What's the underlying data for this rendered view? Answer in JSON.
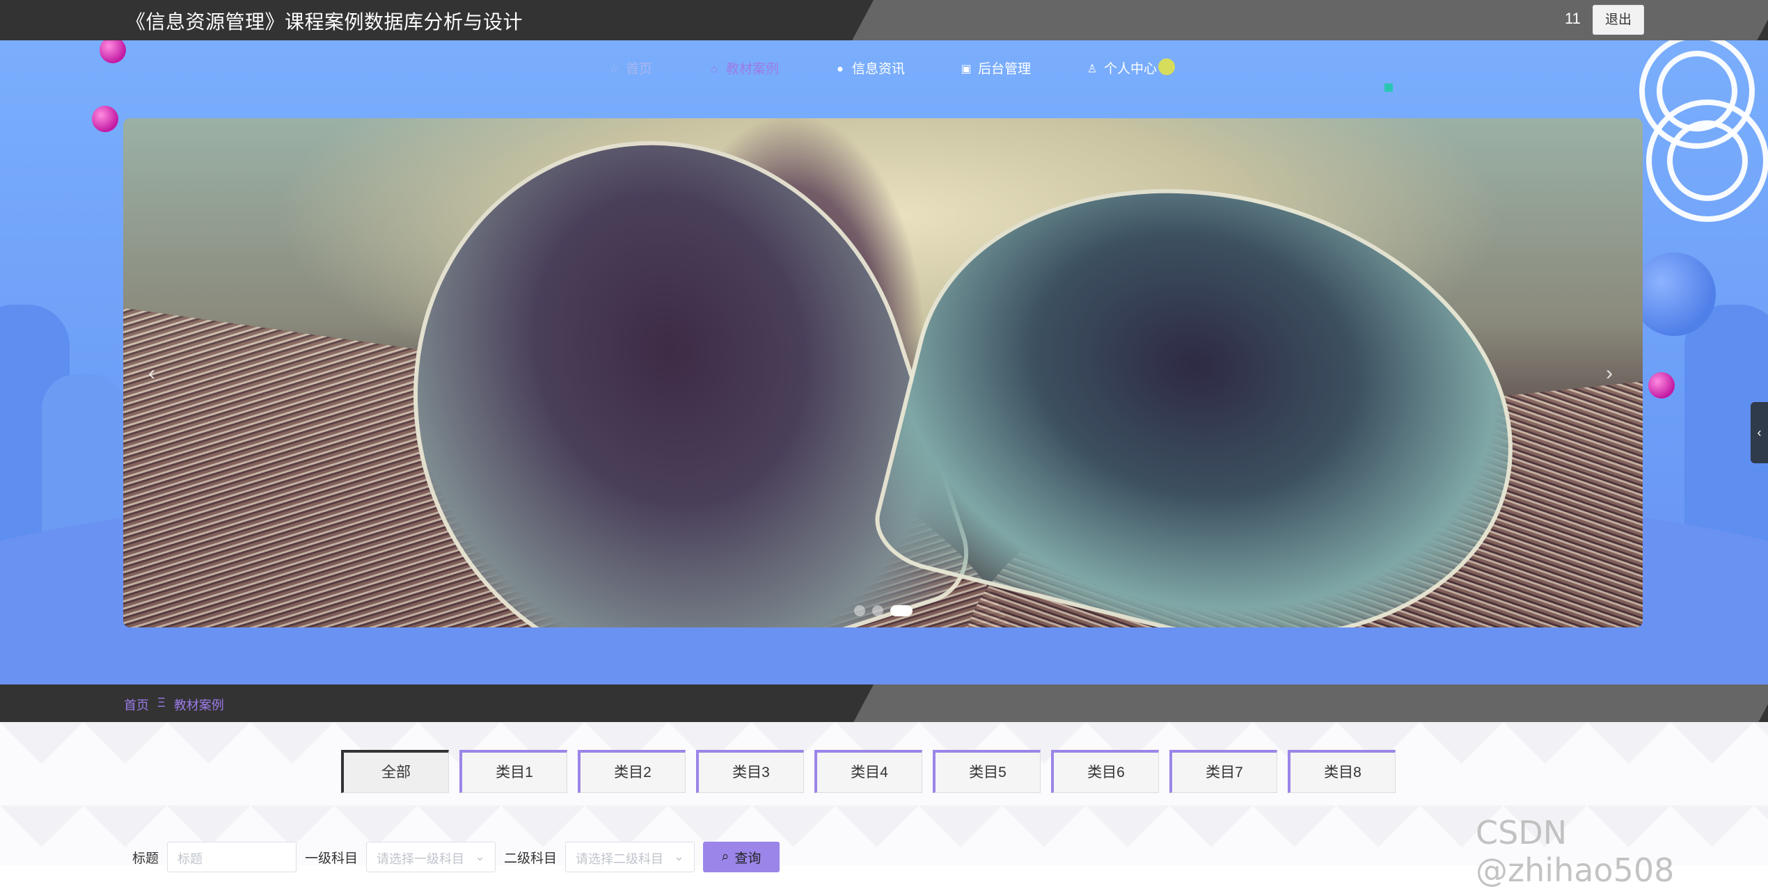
{
  "header": {
    "title": "《信息资源管理》课程案例数据库分析与设计",
    "username": "11",
    "logout_label": "退出"
  },
  "nav": {
    "items": [
      {
        "label": "首页",
        "icon": "star-icon"
      },
      {
        "label": "教材案例",
        "icon": "bag-icon"
      },
      {
        "label": "信息资讯",
        "icon": "info-circle-icon"
      },
      {
        "label": "后台管理",
        "icon": "box-icon"
      },
      {
        "label": "个人中心",
        "icon": "user-icon"
      }
    ]
  },
  "carousel": {
    "prev": "‹",
    "next": "›",
    "slide_count": 3,
    "active_index": 2
  },
  "breadcrumb": {
    "home": "首页",
    "separator": "Ξ",
    "current": "教材案例"
  },
  "categories": [
    "全部",
    "类目1",
    "类目2",
    "类目3",
    "类目4",
    "类目5",
    "类目6",
    "类目7",
    "类目8"
  ],
  "filters": {
    "title_label": "标题",
    "title_placeholder": "标题",
    "level1_label": "一级科目",
    "level1_placeholder": "请选择一级科目",
    "level2_label": "二级科目",
    "level2_placeholder": "请选择二级科目",
    "query_label": "查询"
  },
  "watermark": "CSDN @zhihao508",
  "colors": {
    "accent": "#9b7be8",
    "header_bg": "#333333",
    "hero_blue": "#7aaefc"
  }
}
